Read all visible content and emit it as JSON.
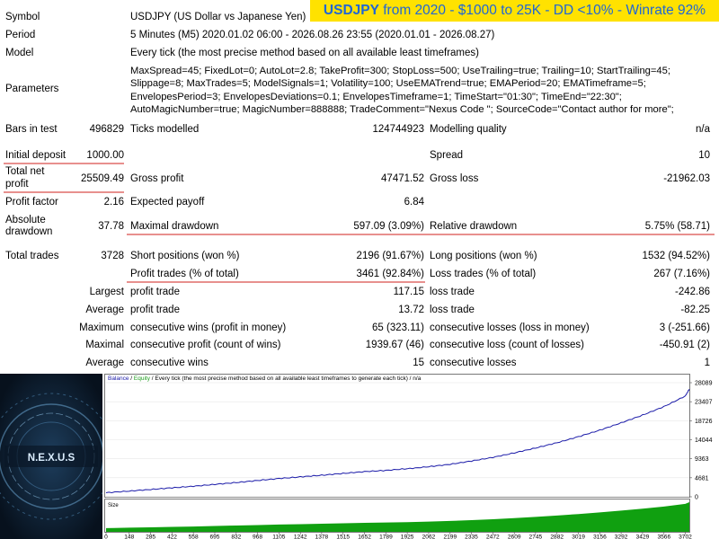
{
  "banner": {
    "symbol": "USDJPY",
    "rest": "from 2020 - $1000 to 25K - DD <10% - Winrate 92%"
  },
  "report": {
    "symbol_label": "Symbol",
    "symbol_value": "USDJPY (US Dollar vs Japanese Yen)",
    "period_label": "Period",
    "period_value": "5 Minutes (M5) 2020.01.02 06:00 - 2026.08.26 23:55 (2020.01.01 - 2026.08.27)",
    "model_label": "Model",
    "model_value": "Every tick (the most precise method based on all available least timeframes)",
    "parameters_label": "Parameters",
    "parameters_value": "MaxSpread=45; FixedLot=0; AutoLot=2.8; TakeProfit=300; StopLoss=500; UseTrailing=true; Trailing=10; StartTrailing=45; Slippage=8; MaxTrades=5; ModelSignals=1; Volatility=100; UseEMATrend=true; EMAPeriod=20; EMATimeframe=5; EnvelopesPeriod=3; EnvelopesDeviations=0.1; EnvelopesTimeframe=1; TimeStart=\"01:30\"; TimeEnd=\"22:30\"; AutoMagicNumber=true; MagicNumber=888888; TradeComment=\"Nexus Code \"; SourceCode=\"Contact author for more\";",
    "bars_label": "Bars in test",
    "bars_value": "496829",
    "ticks_label": "Ticks modelled",
    "ticks_value": "124744923",
    "quality_label": "Modelling quality",
    "quality_value": "n/a",
    "deposit_label": "Initial deposit",
    "deposit_value": "1000.00",
    "spread_label": "Spread",
    "spread_value": "10",
    "net_label_1": "Total net",
    "net_label_2": "profit",
    "net_value": "25509.49",
    "gross_profit_label": "Gross profit",
    "gross_profit_value": "47471.52",
    "gross_loss_label": "Gross loss",
    "gross_loss_value": "-21962.03",
    "pf_label": "Profit factor",
    "pf_value": "2.16",
    "payoff_label": "Expected payoff",
    "payoff_value": "6.84",
    "abs_dd_label_1": "Absolute",
    "abs_dd_label_2": "drawdown",
    "abs_dd_value": "37.78",
    "max_dd_label": "Maximal drawdown",
    "max_dd_value": "597.09 (3.09%)",
    "rel_dd_label": "Relative drawdown",
    "rel_dd_value": "5.75% (58.71)",
    "trades_label": "Total trades",
    "trades_value": "3728",
    "short_label": "Short positions (won %)",
    "short_value": "2196 (91.67%)",
    "long_label": "Long positions (won %)",
    "long_value": "1532 (94.52%)",
    "ptrades_label": "Profit trades (% of total)",
    "ptrades_value": "3461 (92.84%)",
    "ltrades_label": "Loss trades (% of total)",
    "ltrades_value": "267 (7.16%)",
    "largest_label": "Largest",
    "largest_profit_label": "profit trade",
    "largest_profit_value": "117.15",
    "largest_loss_label": "loss trade",
    "largest_loss_value": "-242.86",
    "average_label": "Average",
    "average_profit_label": "profit trade",
    "average_profit_value": "13.72",
    "average_loss_label": "loss trade",
    "average_loss_value": "-82.25",
    "maximum_label": "Maximum",
    "max_wins_label": "consecutive wins (profit in money)",
    "max_wins_value": "65 (323.11)",
    "max_losses_label": "consecutive losses (loss in money)",
    "max_losses_value": "3 (-251.66)",
    "maximal_label": "Maximal",
    "maximal_profit_label": "consecutive profit (count of wins)",
    "maximal_profit_value": "1939.67 (46)",
    "maximal_loss_label": "consecutive loss (count of losses)",
    "maximal_loss_value": "-450.91 (2)",
    "average2_label": "Average",
    "avg_wins_label": "consecutive wins",
    "avg_wins_value": "15",
    "avg_losses_label": "consecutive losses",
    "avg_losses_value": "1"
  },
  "logo": {
    "text": "N.E.X.U.S"
  },
  "chart_data": {
    "type": "line",
    "title_balance": "Balance",
    "title_sep1": " / ",
    "title_equity": "Equity",
    "title_rest": " / Every tick (the most precise method based on all available least timeframes to generate each tick) / n/a",
    "size_label": "Size",
    "y_ticks": [
      "28089",
      "23407",
      "18726",
      "14044",
      "9363",
      "4681",
      "0"
    ],
    "x_ticks": [
      "0",
      "148",
      "285",
      "422",
      "558",
      "695",
      "832",
      "968",
      "1105",
      "1242",
      "1378",
      "1515",
      "1652",
      "1789",
      "1925",
      "2062",
      "2199",
      "2335",
      "2472",
      "2609",
      "2745",
      "2882",
      "3019",
      "3156",
      "3292",
      "3429",
      "3566",
      "3702"
    ],
    "ylim": [
      0,
      28089
    ],
    "xlim": [
      0,
      3728
    ],
    "series": [
      {
        "name": "Balance",
        "color": "#1a1aa8",
        "x": [
          0,
          148,
          285,
          422,
          558,
          695,
          832,
          968,
          1105,
          1242,
          1378,
          1515,
          1652,
          1789,
          1925,
          2062,
          2199,
          2335,
          2472,
          2609,
          2745,
          2882,
          3019,
          3156,
          3292,
          3429,
          3566,
          3702,
          3728
        ],
        "y": [
          1000,
          1400,
          1800,
          2200,
          2600,
          3050,
          3500,
          4000,
          4500,
          4900,
          5300,
          5750,
          6200,
          6500,
          6900,
          7400,
          8000,
          8800,
          9700,
          10800,
          12000,
          13300,
          14800,
          16400,
          18200,
          20100,
          22200,
          24800,
          26500
        ]
      }
    ],
    "colors": {
      "balance": "#1a1aa8",
      "equity": "#1a9a1a",
      "size_fill": "#10a010"
    }
  }
}
